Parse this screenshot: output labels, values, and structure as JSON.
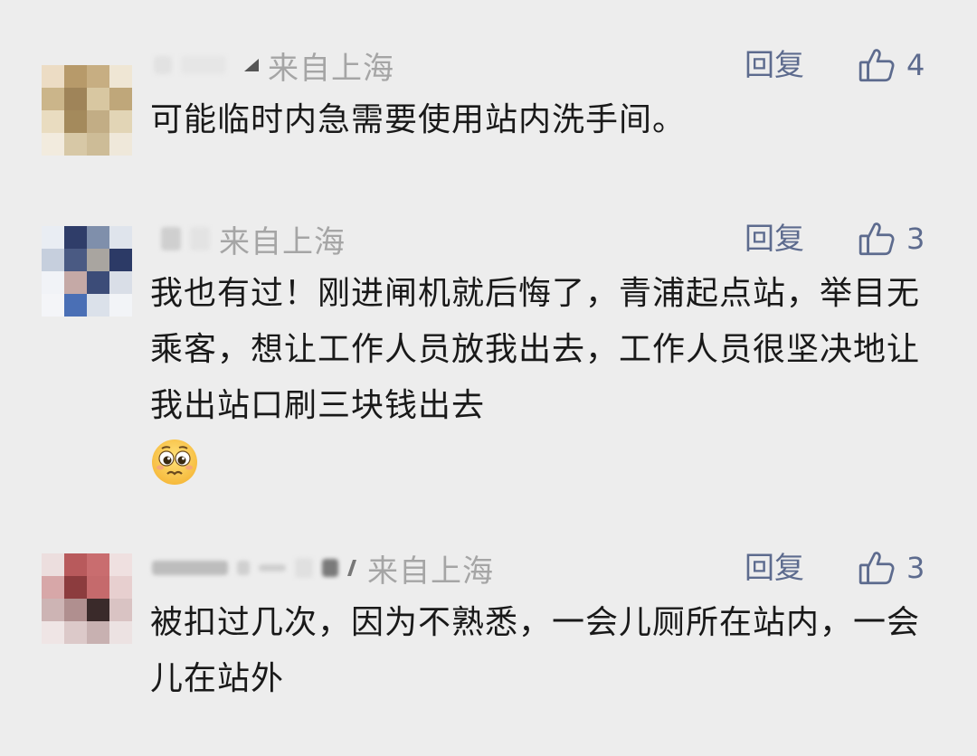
{
  "comments": [
    {
      "location": "来自上海",
      "reply_label": "回复",
      "likes": "4",
      "text": "可能临时内急需要使用站内洗手间。",
      "avatar_colors": [
        "#ecdcc4",
        "#b79a6a",
        "#c7ae82",
        "#efe6d4",
        "#cbb58a",
        "#9f8459",
        "#d8c7a1",
        "#bfa77a",
        "#e9dcc0",
        "#a48a5c",
        "#c2ad85",
        "#e2d5b6",
        "#f2ebde",
        "#d7c8a6",
        "#cdbc97",
        "#efe8da"
      ]
    },
    {
      "location": "来自上海",
      "reply_label": "回复",
      "likes": "3",
      "text": "我也有过！刚进闸机就后悔了，青浦起点站，举目无乘客，想让工作人员放我出去，工作人员很坚决地让我出站口刷三块钱出去",
      "emoji": "pleading-face-emoji",
      "avatar_colors": [
        "#e9edf3",
        "#2f3d69",
        "#7f8fab",
        "#dfe4ec",
        "#c6cfdd",
        "#4a5a83",
        "#a9a5a0",
        "#2c3a66",
        "#f1f3f7",
        "#c5a9a6",
        "#3c4c78",
        "#d9dee7",
        "#f4f5f8",
        "#4a6fb5",
        "#dbe1ea",
        "#f2f4f7"
      ]
    },
    {
      "location": "来自上海",
      "reply_label": "回复",
      "likes": "3",
      "text": "被扣过几次，因为不熟悉，一会儿厕所在站内，一会儿在站外",
      "avatar_colors": [
        "#ecdede",
        "#b85a5c",
        "#c96d6f",
        "#efe0e0",
        "#d7a7a8",
        "#8c3c3e",
        "#c56a6c",
        "#e7cfcf",
        "#cdb4b4",
        "#b08f8f",
        "#3a2a2a",
        "#d9c3c3",
        "#efe5e5",
        "#dcc9c9",
        "#c8b1b1",
        "#ece2e2"
      ]
    }
  ]
}
